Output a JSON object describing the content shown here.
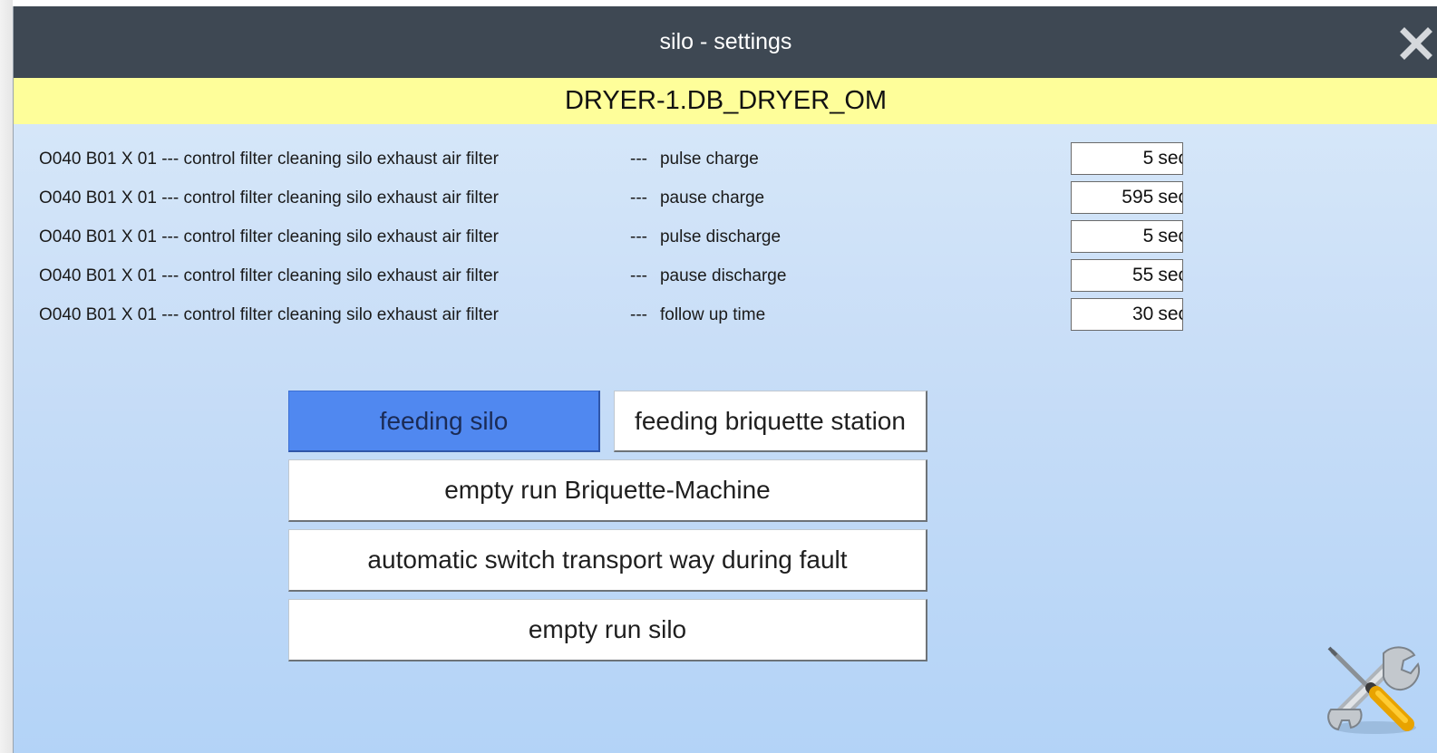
{
  "window": {
    "title": "silo - settings",
    "subtitle": "DRYER-1.DB_DRYER_OM"
  },
  "settings": [
    {
      "description": "O040 B01 X 01 --- control filter cleaning silo exhaust air filter",
      "dash": "---",
      "parameter": "pulse charge",
      "value": "5",
      "unit": "sec"
    },
    {
      "description": "O040 B01 X 01 --- control filter cleaning silo exhaust air filter",
      "dash": "---",
      "parameter": "pause charge",
      "value": "595",
      "unit": "sec"
    },
    {
      "description": "O040 B01 X 01 --- control filter cleaning silo exhaust air filter",
      "dash": "---",
      "parameter": "pulse discharge",
      "value": "5",
      "unit": "sec"
    },
    {
      "description": "O040 B01 X 01 --- control filter cleaning silo exhaust air filter",
      "dash": "---",
      "parameter": "pause discharge",
      "value": "55",
      "unit": "sec"
    },
    {
      "description": "O040 B01 X 01 --- control filter cleaning silo exhaust air filter",
      "dash": "---",
      "parameter": "follow up time",
      "value": "30",
      "unit": "sec"
    }
  ],
  "buttons": {
    "feeding_silo": "feeding silo",
    "feeding_briquette_station": "feeding briquette station",
    "empty_run_briquette": "empty run Briquette-Machine",
    "auto_switch": "automatic switch transport way during fault",
    "empty_run_silo": "empty run silo"
  },
  "icons": {
    "close": "close-icon",
    "tools": "tools-icon"
  },
  "colors": {
    "titlebar": "#3e4853",
    "subheader": "#fefe9a",
    "active_button": "#5088f0"
  }
}
